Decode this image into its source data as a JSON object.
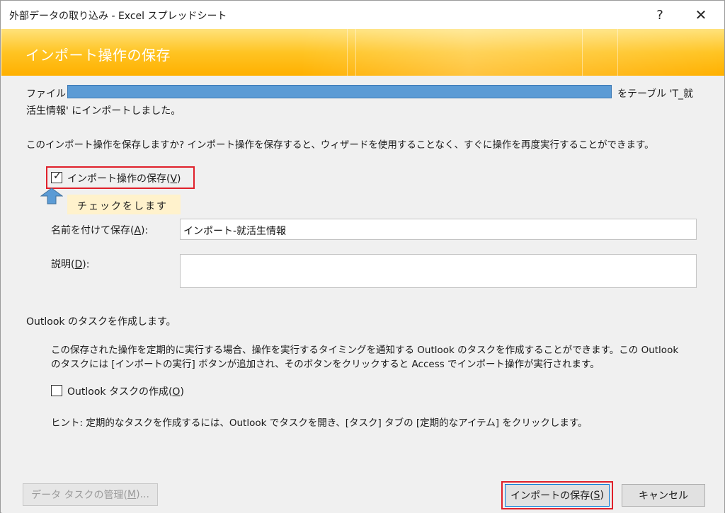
{
  "window": {
    "title": "外部データの取り込み - Excel スプレッドシート",
    "help_label": "?",
    "close_label": "✕"
  },
  "banner": {
    "title": "インポート操作の保存"
  },
  "info": {
    "line1_prefix": "ファイル '",
    "line1_suffix": "をテーブル 'T_就",
    "line2": "活生情報' にインポートしました。"
  },
  "question": "このインポート操作を保存しますか? インポート操作を保存すると、ウィザードを使用することなく、すぐに操作を再度実行することができます。",
  "save_import": {
    "checked": true,
    "label_pre": "インポート操作の保存(",
    "label_key": "V",
    "label_post": ")"
  },
  "tooltip": "チェックをします",
  "save_as": {
    "label_pre": "名前を付けて保存(",
    "label_key": "A",
    "label_post": "):",
    "value": "インポート-就活生情報"
  },
  "description": {
    "label_pre": "説明(",
    "label_key": "D",
    "label_post": "):",
    "value": ""
  },
  "outlook": {
    "heading": "Outlook のタスクを作成します。",
    "body_line1": "この保存された操作を定期的に実行する場合、操作を実行するタイミングを通知する Outlook のタスクを作成することができます。この Outlook",
    "body_line2": "のタスクには [インポートの実行] ボタンが追加され、そのボタンをクリックすると Access でインポート操作が実行されます。",
    "checkbox_checked": false,
    "checkbox_label_pre": "Outlook タスクの作成(",
    "checkbox_label_key": "O",
    "checkbox_label_post": ")",
    "hint": "ヒント: 定期的なタスクを作成するには、Outlook でタスクを開き、[タスク] タブの [定期的なアイテム] をクリックします。"
  },
  "footer": {
    "manage_pre": "データ タスクの管理(",
    "manage_key": "M",
    "manage_post": ")...",
    "save_pre": "インポートの保存(",
    "save_key": "S",
    "save_post": ")",
    "cancel": "キャンセル"
  },
  "colors": {
    "banner": "#ffc423",
    "highlight": "#e0202a",
    "redaction": "#5b9bd5",
    "tooltip_bg": "#fff2cc",
    "arrow": "#5b9bd5"
  }
}
